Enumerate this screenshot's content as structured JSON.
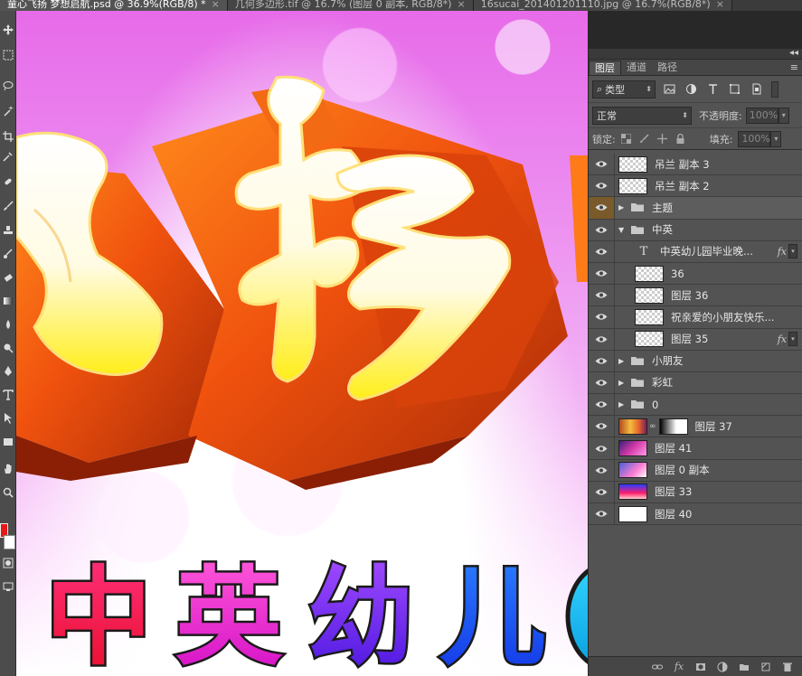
{
  "doc_tabs": [
    {
      "label": "童心飞扬 梦想启航.psd @ 36.9%(RGB/8) *",
      "active": true
    },
    {
      "label": "几何多边形.tif @ 16.7% (图层 0 副本, RGB/8*)",
      "active": false
    },
    {
      "label": "16sucai_201401201110.jpg @ 16.7%(RGB/8*)",
      "active": false
    }
  ],
  "tools": [
    "move-icon",
    "marquee-icon",
    "lasso-icon",
    "magic-wand-icon",
    "crop-icon",
    "eyedropper-icon",
    "healing-icon",
    "brush-icon",
    "stamp-icon",
    "history-brush-icon",
    "eraser-icon",
    "gradient-icon",
    "blur-icon",
    "dodge-icon",
    "pen-icon",
    "type-icon",
    "path-select-icon",
    "shape-icon",
    "hand-icon",
    "zoom-icon"
  ],
  "colors": {
    "foreground": "#e81616",
    "background": "#ffffff",
    "panel": "#535353"
  },
  "canvas_text": {
    "headline": "飞扬",
    "subtitle_chars": [
      "中",
      "英",
      "幼",
      "儿"
    ]
  },
  "panel": {
    "tabs": [
      "图层",
      "通道",
      "路径"
    ],
    "kind_filter": "类型",
    "blend_mode": "正常",
    "opacity_label": "不透明度:",
    "opacity_value": "100%",
    "lock_label": "锁定:",
    "fill_label": "填充:",
    "fill_value": "100%",
    "fx_label": "fx"
  },
  "layers": [
    {
      "name": "吊兰 副本 3",
      "type": "pixel",
      "indent": 0
    },
    {
      "name": "吊兰 副本 2",
      "type": "pixel",
      "indent": 0
    },
    {
      "name": "主题",
      "type": "group",
      "indent": 0,
      "expanded": false,
      "selected": true
    },
    {
      "name": "中英",
      "type": "group",
      "indent": 0,
      "expanded": true
    },
    {
      "name": "中英幼儿园毕业晚...",
      "type": "text",
      "indent": 1,
      "fx": true
    },
    {
      "name": "36",
      "type": "pixel",
      "indent": 1
    },
    {
      "name": "图层 36",
      "type": "pixel",
      "indent": 1
    },
    {
      "name": "祝亲爱的小朋友快乐...",
      "type": "pixel",
      "indent": 1
    },
    {
      "name": "图层 35",
      "type": "pixel",
      "indent": 1,
      "fx": true
    },
    {
      "name": "小朋友",
      "type": "group",
      "indent": 0,
      "expanded": false
    },
    {
      "name": "彩虹",
      "type": "group",
      "indent": 0,
      "expanded": false
    },
    {
      "name": "0",
      "type": "group",
      "indent": 0,
      "expanded": false
    },
    {
      "name": "图层 37",
      "type": "masked",
      "indent": 0
    },
    {
      "name": "图层 41",
      "type": "image41",
      "indent": 0
    },
    {
      "name": "图层 0 副本",
      "type": "image0",
      "indent": 0
    },
    {
      "name": "图层 33",
      "type": "image33",
      "indent": 0
    },
    {
      "name": "图层 40",
      "type": "white",
      "indent": 0
    }
  ]
}
